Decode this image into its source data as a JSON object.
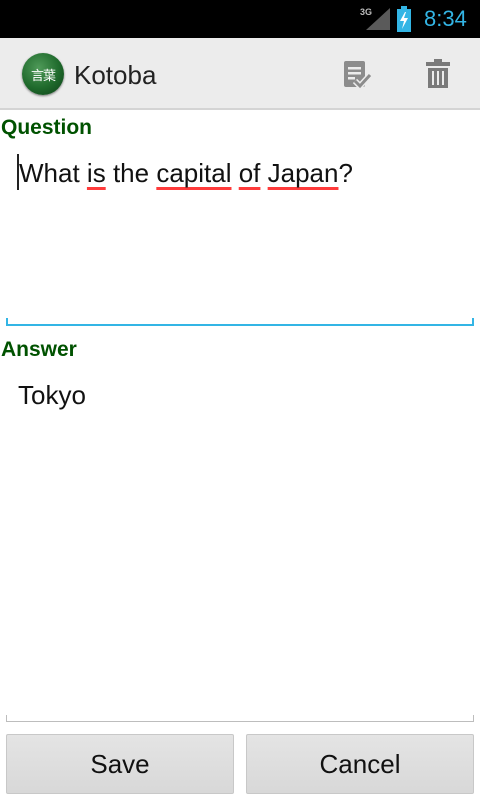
{
  "status_bar": {
    "network": "3G",
    "time": "8:34"
  },
  "action_bar": {
    "logo_text": "言葉",
    "title": "Kotoba",
    "done_icon": "checklist-icon",
    "delete_icon": "trash-icon"
  },
  "form": {
    "question_label": "Question",
    "question_words": [
      "What",
      "is",
      "the",
      "capital",
      "of",
      "Japan",
      "?"
    ],
    "answer_label": "Answer",
    "answer_value": "Tokyo"
  },
  "buttons": {
    "save": "Save",
    "cancel": "Cancel"
  },
  "colors": {
    "accent": "#33b5e5",
    "label_green": "#005200",
    "spell_error": "#ff3b3b"
  }
}
